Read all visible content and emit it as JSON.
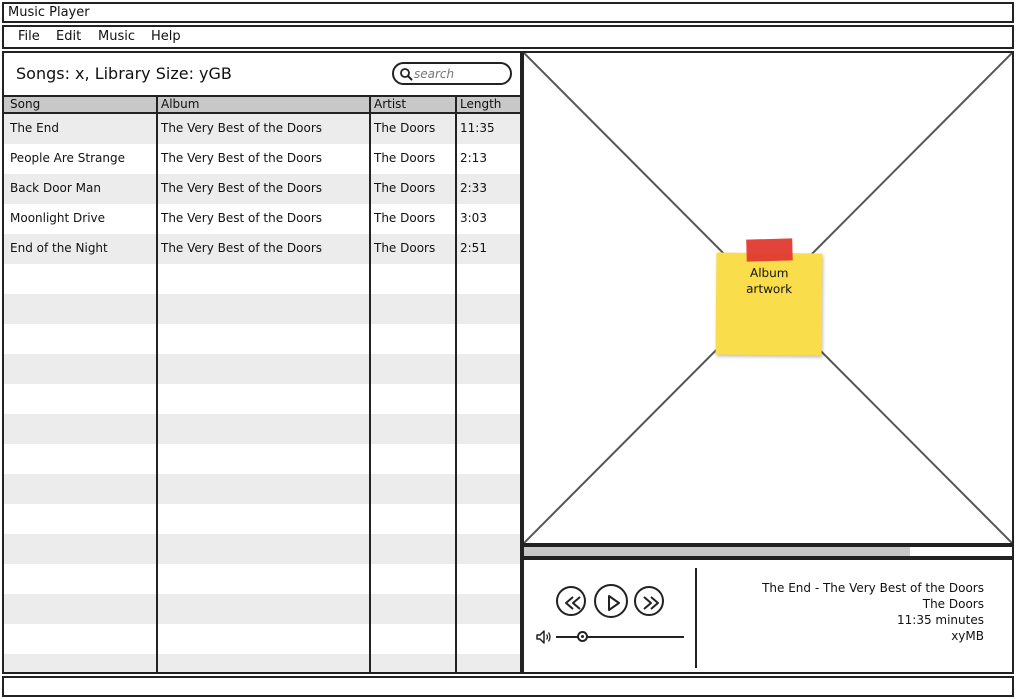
{
  "window": {
    "title": "Music Player"
  },
  "menu": {
    "items": [
      "File",
      "Edit",
      "Music",
      "Help"
    ]
  },
  "library": {
    "info": "Songs: x, Library Size: yGB",
    "search_placeholder": "search"
  },
  "table": {
    "columns": [
      "Song",
      "Album",
      "Artist",
      "Length"
    ],
    "rows": [
      [
        "The End",
        "The Very Best of the Doors",
        "The Doors",
        "11:35"
      ],
      [
        "People Are Strange",
        "The Very Best of the Doors",
        "The Doors",
        "2:13"
      ],
      [
        "Back Door Man",
        "The Very Best of the Doors",
        "The Doors",
        "2:33"
      ],
      [
        "Moonlight Drive",
        "The Very Best of the Doors",
        "The Doors",
        "3:03"
      ],
      [
        "End of the Night",
        "The Very Best of the Doors",
        "The Doors",
        "2:51"
      ]
    ]
  },
  "artwork": {
    "note_line1": "Album",
    "note_line2": "artwork",
    "note_color": "#f9dd4a",
    "tape_color": "#e03a2f"
  },
  "playback": {
    "progress": 0.79,
    "volume": 0.2
  },
  "now_playing": {
    "line1": "The End - The Very Best of the Doors",
    "line2": "The Doors",
    "line3": "11:35 minutes",
    "line4": "xyMB"
  },
  "icons": {
    "search": "search-icon",
    "rewind": "rewind-icon",
    "play": "play-icon",
    "fast_forward": "fast-forward-icon",
    "volume": "volume-icon"
  }
}
